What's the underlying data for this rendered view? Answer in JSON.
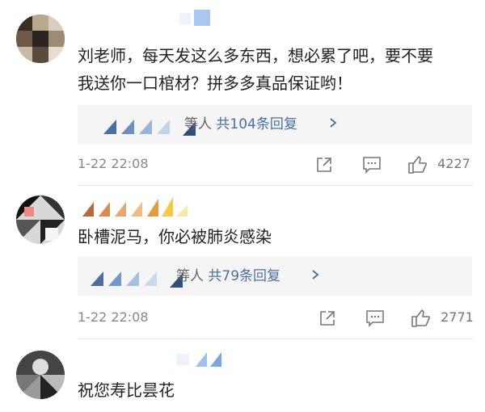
{
  "comments": [
    {
      "text_line1": "刘老师，每天发这么多东西，想必累了吧，要不要",
      "text_line2": "我送你一口棺材？拼多多真品保证哟！",
      "reply_prefix": "等人",
      "reply_link": "共104条回复",
      "time": "1-22 22:08",
      "likes": "4227"
    },
    {
      "text_line1": "卧槽泥马，你必被肺炎感染",
      "reply_prefix": "等人",
      "reply_link": "共79条回复",
      "time": "1-22 22:08",
      "likes": "2771"
    },
    {
      "text_line1": "祝您寿比昙花"
    }
  ],
  "icons": {
    "share": "share-icon",
    "comment": "comment-icon",
    "like": "thumbs-up-icon",
    "chevron": "chevron-right-icon"
  },
  "colors": {
    "link": "#4a6fa5",
    "meta": "#888888",
    "reply_bg": "#f5f5f5"
  }
}
